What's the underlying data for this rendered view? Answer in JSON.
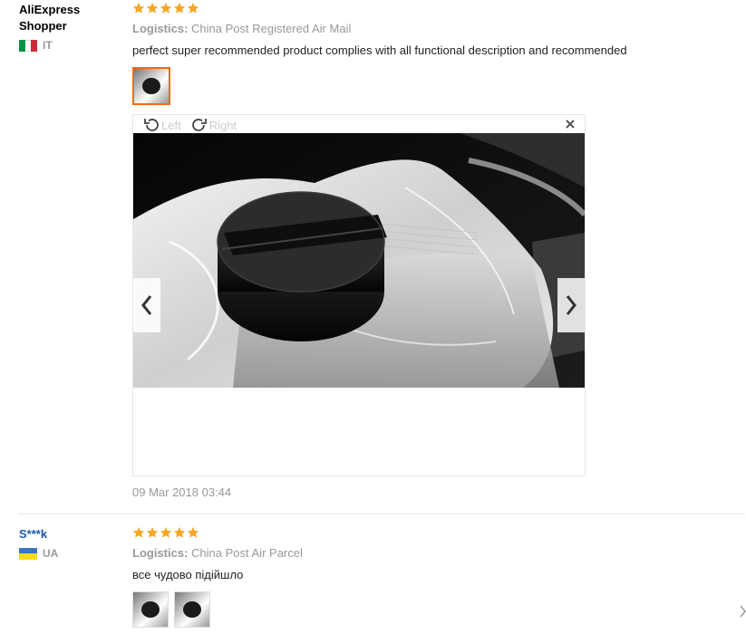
{
  "reviews": [
    {
      "user_name": "AliExpress Shopper",
      "country_code": "IT",
      "flag_colors": [
        "#009246",
        "#ffffff",
        "#ce2b37"
      ],
      "rating": 5,
      "logistics_label": "Logistics:",
      "logistics_value": "China Post Registered Air Mail",
      "text": "perfect super recommended product complies with all functional description and recommended",
      "date": "09 Mar 2018 03:44"
    },
    {
      "user_name": "S***k",
      "country_code": "UA",
      "flag_colors": [
        "#3a75c4",
        "#f9dd16"
      ],
      "rating": 5,
      "logistics_label": "Logistics:",
      "logistics_value": "China Post Air Parcel",
      "text": "все чудово підійшло"
    }
  ],
  "viewer": {
    "rotate_left_label": "Left",
    "rotate_right_label": "Right"
  },
  "colors": {
    "star": "#f5a623",
    "accent": "#f26a1b",
    "link": "#1a5aa7"
  }
}
